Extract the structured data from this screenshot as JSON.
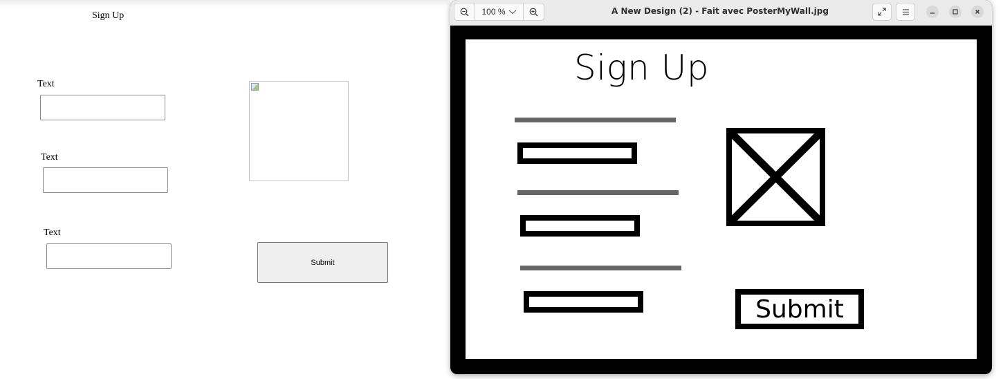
{
  "form": {
    "title": "Sign Up",
    "fields": [
      {
        "label": "Text",
        "value": ""
      },
      {
        "label": "Text",
        "value": ""
      },
      {
        "label": "Text",
        "value": ""
      }
    ],
    "submit_label": "Submit"
  },
  "viewer": {
    "zoom_level": "100 %",
    "window_title": "A New Design (2) - Fait avec PosterMyWall.jpg",
    "icons": {
      "zoom_out": "zoom-out-icon",
      "zoom_in": "zoom-in-icon",
      "fullscreen": "fullscreen-icon",
      "menu": "hamburger-menu-icon",
      "minimize": "minimize-icon",
      "maximize": "maximize-icon",
      "close": "close-icon"
    },
    "mockup": {
      "title": "Sign Up",
      "submit_label": "Submit"
    }
  },
  "colors": {
    "header_bg": "#ebebeb",
    "frame": "#000000",
    "placeholder_line": "#666666",
    "button_bg": "#efefef"
  }
}
